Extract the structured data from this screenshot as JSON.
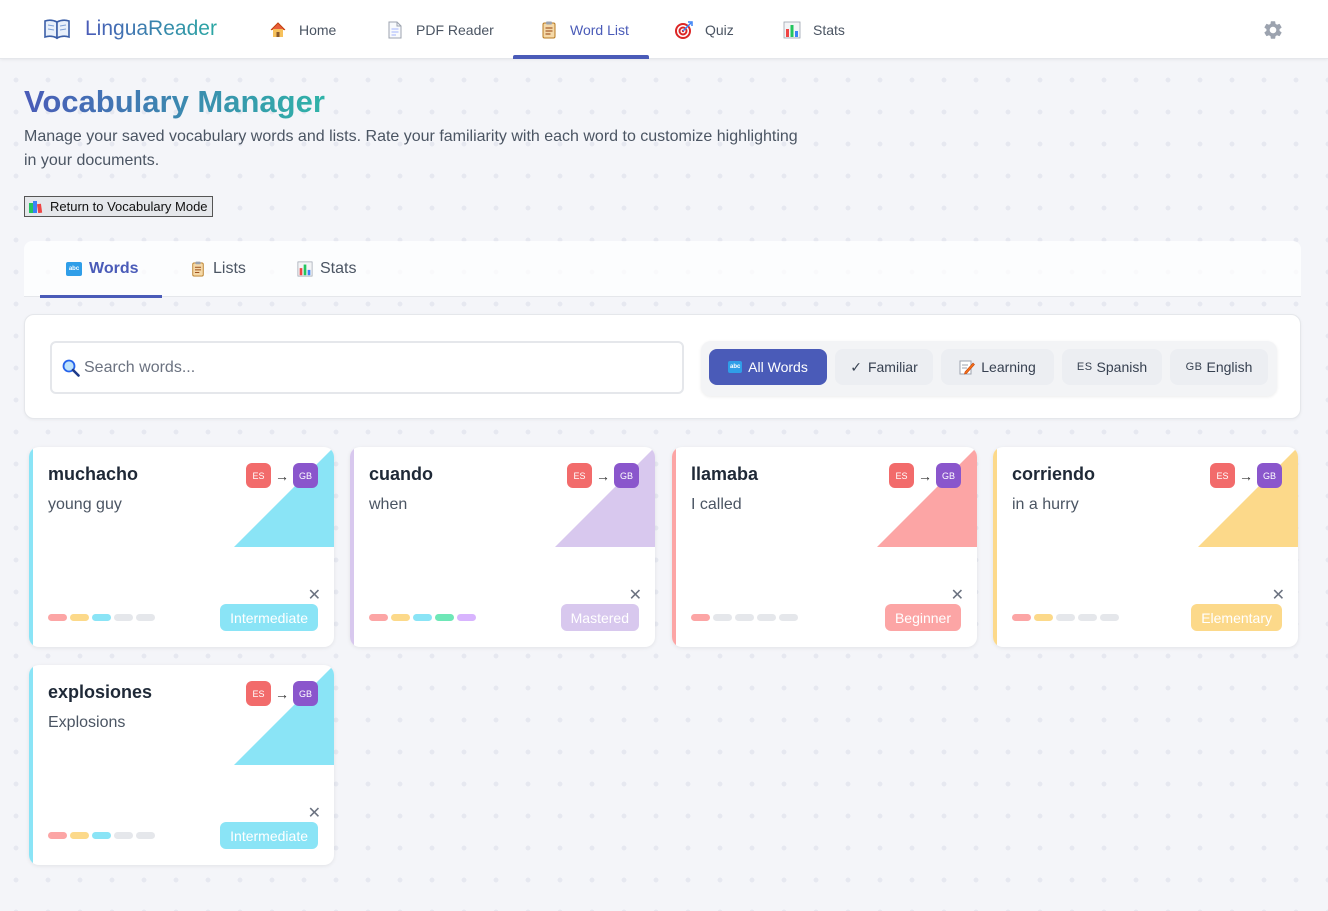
{
  "app": {
    "name": "LinguaReader"
  },
  "nav": [
    {
      "label": "Home",
      "icon": "house-icon"
    },
    {
      "label": "PDF Reader",
      "icon": "document-icon"
    },
    {
      "label": "Word List",
      "icon": "clipboard-icon",
      "active": true
    },
    {
      "label": "Quiz",
      "icon": "target-icon"
    },
    {
      "label": "Stats",
      "icon": "bar-chart-icon"
    }
  ],
  "header": {
    "title": "Vocabulary Manager",
    "description": "Manage your saved vocabulary words and lists. Rate your familiarity with each word to customize highlighting in your documents.",
    "return_button": "Return to Vocabulary Mode"
  },
  "tabs": [
    {
      "label": "Words",
      "icon": "abc-icon",
      "active": true
    },
    {
      "label": "Lists",
      "icon": "clipboard-icon"
    },
    {
      "label": "Stats",
      "icon": "bar-chart-icon"
    }
  ],
  "search": {
    "placeholder": "Search words...",
    "value": ""
  },
  "filters": [
    {
      "label": "All Words",
      "icon": "abc",
      "active": true
    },
    {
      "label": "Familiar",
      "icon": "✓"
    },
    {
      "label": "Learning",
      "icon": "memo"
    },
    {
      "label": "Spanish",
      "icon": "ES"
    },
    {
      "label": "English",
      "icon": "GB"
    }
  ],
  "lang_codes": {
    "source": "ES",
    "target": "GB",
    "arrow": "→"
  },
  "close_symbol": "✕",
  "levels": {
    "Beginner": {
      "color": "#fca5a5",
      "filled": 1
    },
    "Elementary": {
      "color": "#fcd98a",
      "filled": 2
    },
    "Intermediate": {
      "color": "#8ae4f6",
      "filled": 3
    },
    "Mastered": {
      "color": "#d8c8ee",
      "filled": 5
    }
  },
  "dot_colors": [
    "#fca5a5",
    "#fcd98a",
    "#8ae4f6",
    "#6ee7b7",
    "#d8b4fe"
  ],
  "words": [
    {
      "word": "muchacho",
      "translation": "young guy",
      "level": "Intermediate"
    },
    {
      "word": "cuando",
      "translation": "when",
      "level": "Mastered"
    },
    {
      "word": "llamaba",
      "translation": "I called",
      "level": "Beginner"
    },
    {
      "word": "corriendo",
      "translation": "in a hurry",
      "level": "Elementary"
    },
    {
      "word": "explosiones",
      "translation": "Explosions",
      "level": "Intermediate"
    }
  ]
}
